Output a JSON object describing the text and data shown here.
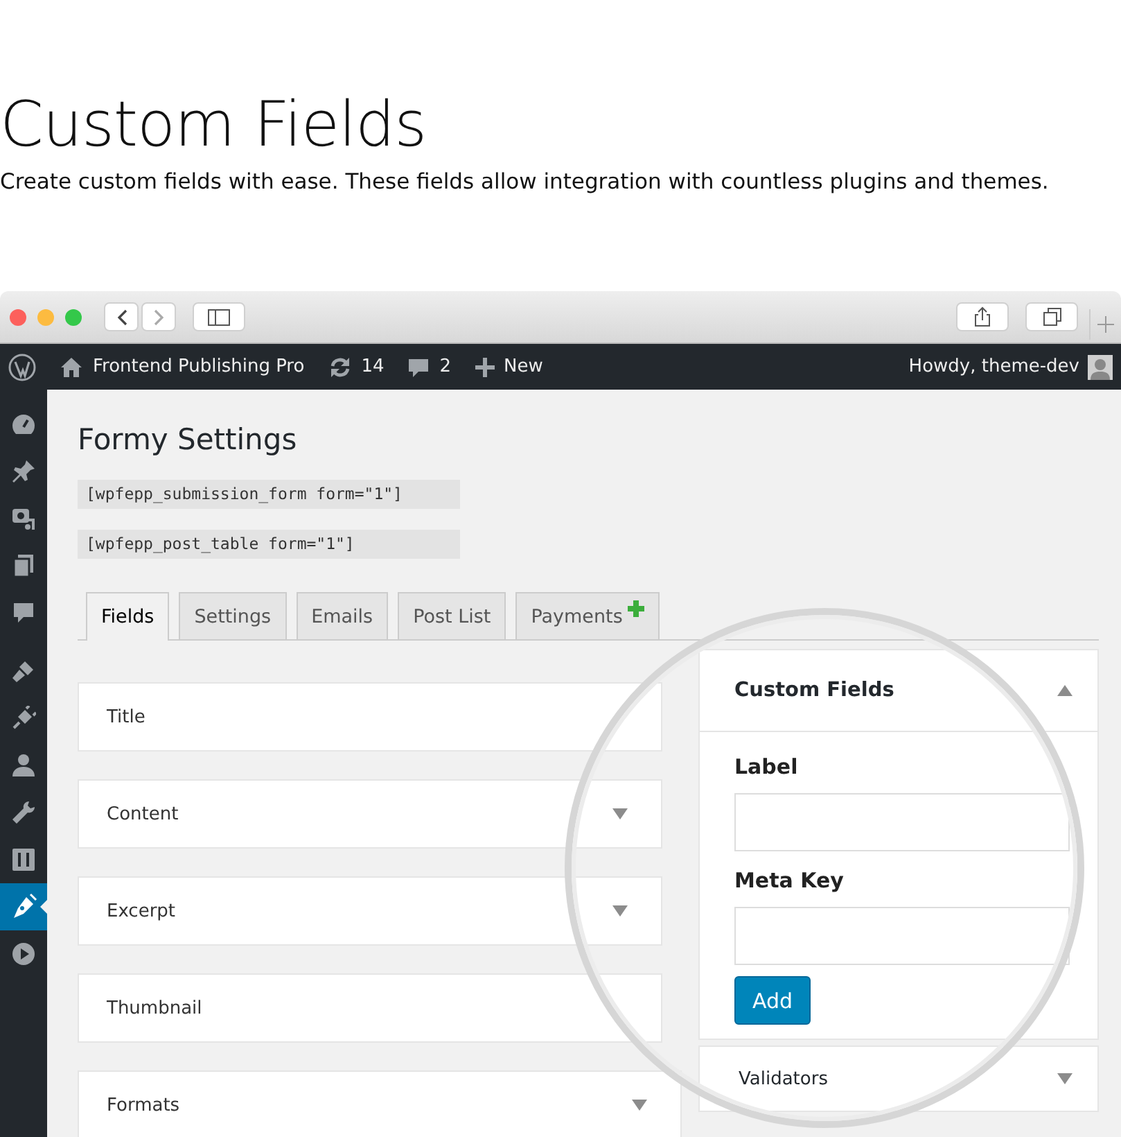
{
  "hero": {
    "title": "Custom Fields",
    "subtitle": "Create custom fields with ease. These fields allow integration with countless plugins and themes."
  },
  "admin_bar": {
    "site": "Frontend Publishing Pro",
    "updates": "14",
    "comments": "2",
    "new": "New",
    "greeting": "Howdy, theme-dev"
  },
  "sidebar": {
    "items": [
      {
        "selected": false
      },
      {
        "selected": false
      },
      {
        "selected": false
      },
      {
        "selected": false
      },
      {
        "selected": false
      },
      {
        "selected": false
      },
      {
        "selected": false
      },
      {
        "selected": false
      },
      {
        "selected": false
      },
      {
        "selected": false
      },
      {
        "selected": true
      },
      {
        "selected": false
      }
    ]
  },
  "page": {
    "title": "Formy Settings",
    "shortcodes": [
      "[wpfepp_submission_form form=\"1\"]",
      "[wpfepp_post_table form=\"1\"]"
    ],
    "tabs": [
      {
        "label": "Fields",
        "selected": true,
        "plus": false
      },
      {
        "label": "Settings",
        "selected": false,
        "plus": false
      },
      {
        "label": "Emails",
        "selected": false,
        "plus": false
      },
      {
        "label": "Post List",
        "selected": false,
        "plus": false
      },
      {
        "label": "Payments",
        "selected": false,
        "plus": true
      }
    ],
    "fields": [
      {
        "label": "Title",
        "caret": false
      },
      {
        "label": "Content",
        "caret": true
      },
      {
        "label": "Excerpt",
        "caret": true
      },
      {
        "label": "Thumbnail",
        "caret": false
      },
      {
        "label": "Formats",
        "caret": true
      }
    ],
    "panels": [
      {
        "title": "Custom Fields",
        "expanded": true,
        "inputs": [
          {
            "label": "Label"
          },
          {
            "label": "Meta Key"
          }
        ],
        "button": "Add"
      },
      {
        "title": "Validators",
        "expanded": false
      }
    ]
  }
}
